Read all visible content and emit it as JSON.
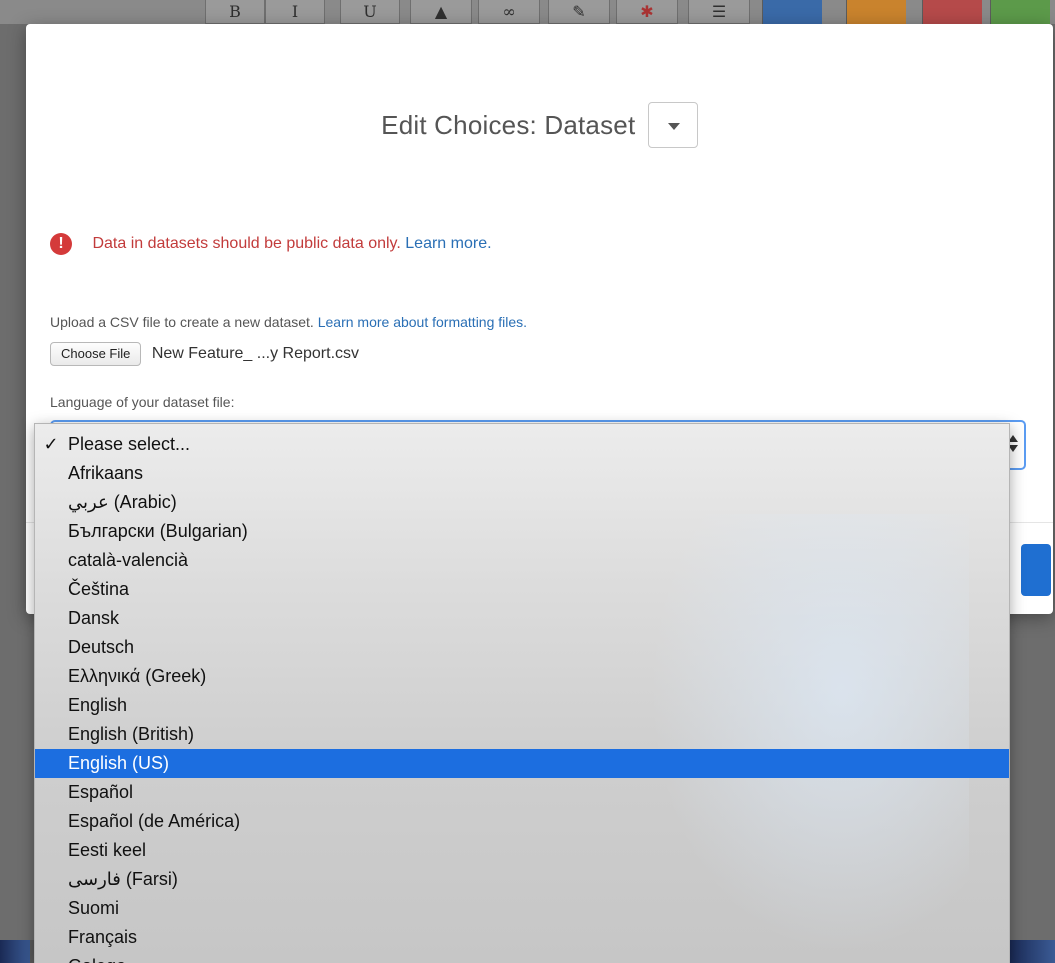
{
  "background": {
    "toolbar_buttons": [
      {
        "label": "B",
        "icon": "bold-icon"
      },
      {
        "label": "I",
        "icon": "italic-icon"
      },
      {
        "label": "U",
        "icon": "underline-icon"
      },
      {
        "label": "▲",
        "icon": "image-icon"
      },
      {
        "label": "∞",
        "icon": "link-icon"
      },
      {
        "label": "✎",
        "icon": "eraser-icon"
      },
      {
        "label": "✱",
        "icon": "asterisk-icon"
      },
      {
        "label": "☰",
        "icon": "list-icon"
      }
    ],
    "toolbar_colors": [
      "#3a6aa8",
      "#c9832d",
      "#b54a4a",
      "#5c9a4a"
    ]
  },
  "modal": {
    "title": "Edit Choices: Dataset",
    "warning": {
      "text": "Data in datasets should be public data only.",
      "link": "Learn more."
    },
    "upload": {
      "help_text": "Upload a CSV file to create a new dataset.",
      "help_link": "Learn more about formatting files.",
      "choose_file_label": "Choose File",
      "file_name": "New Feature_ ...y Report.csv"
    },
    "language": {
      "label": "Language of your dataset file:",
      "selected_value": "Please select..."
    }
  },
  "dropdown": {
    "checkmark": "✓",
    "highlighted_index": 11,
    "options": [
      "Please select...",
      "Afrikaans",
      "عربي (Arabic)",
      "Български (Bulgarian)",
      "català-valencià",
      "Čeština",
      "Dansk",
      "Deutsch",
      "Ελληνικά (Greek)",
      "English",
      "English (British)",
      "English (US)",
      "Español",
      "Español (de América)",
      "Eesti keel",
      "فارسی (Farsi)",
      "Suomi",
      "Français",
      "Galego"
    ]
  },
  "colors": {
    "accent": "#1c6ee0",
    "warning": "#c23b3b",
    "link": "#2a6fb5"
  }
}
